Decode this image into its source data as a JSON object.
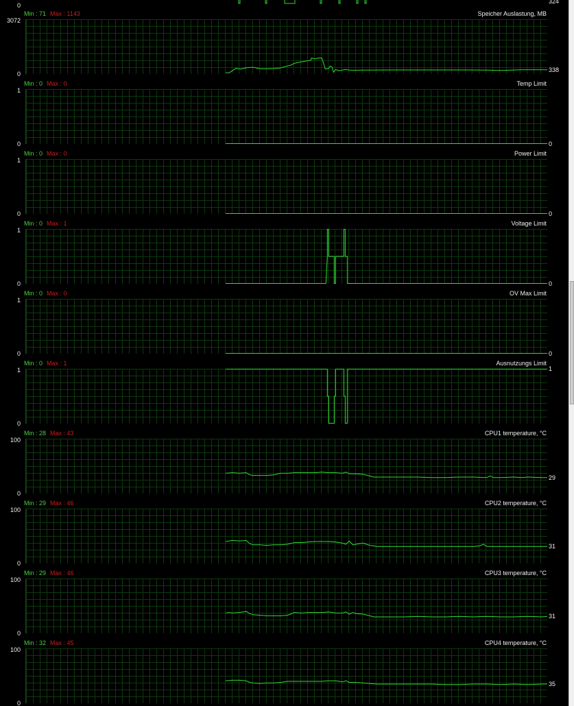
{
  "colors": {
    "line": "#32dc32",
    "min": "#4ccf40",
    "max": "#c81e1e",
    "text": "#f0f0f0",
    "grid": "#0d3a0d"
  },
  "top_partial": {
    "ymin": "0",
    "current": "324"
  },
  "panels": [
    {
      "title": "Speicher Auslastung, MB",
      "min_label": "Min : 71",
      "max_label": "Max : 1143",
      "ymax": "3072",
      "ymin": "0",
      "current": "338",
      "range": [
        0,
        3072
      ],
      "chart_data": {
        "type": "line",
        "x": [
          0,
          5,
          10,
          15,
          22,
          30,
          33,
          40,
          50,
          60,
          70,
          80,
          90,
          95,
          100,
          110,
          120,
          124,
          125,
          130,
          135,
          140,
          145,
          150,
          152,
          155,
          157,
          160,
          165,
          175,
          180,
          185,
          200,
          250,
          300,
          350,
          380,
          400,
          430,
          468
        ],
        "y": [
          71,
          70,
          190,
          320,
          280,
          350,
          360,
          380,
          300,
          290,
          310,
          340,
          450,
          500,
          600,
          680,
          750,
          780,
          900,
          850,
          900,
          900,
          280,
          310,
          450,
          380,
          100,
          250,
          190,
          260,
          220,
          210,
          220,
          230,
          230,
          230,
          220,
          200,
          240,
          240
        ]
      }
    },
    {
      "title": "Temp Limit",
      "min_label": "Min : 0",
      "max_label": "Max : 0",
      "ymax": "1",
      "ymin": "0",
      "current": "0",
      "range": [
        0,
        1
      ],
      "chart_data": {
        "type": "line",
        "x": [
          0,
          468
        ],
        "y": [
          0,
          0
        ]
      }
    },
    {
      "title": "Power Limit",
      "min_label": "Min : 0",
      "max_label": "Max : 0",
      "ymax": "1",
      "ymin": "0",
      "current": "0",
      "range": [
        0,
        1
      ],
      "chart_data": {
        "type": "line",
        "x": [
          0,
          468
        ],
        "y": [
          0,
          0
        ]
      }
    },
    {
      "title": "Voltage Limit",
      "min_label": "Min : 0",
      "max_label": "Max : 1",
      "ymax": "1",
      "ymin": "0",
      "current": "0",
      "range": [
        0,
        1
      ],
      "chart_data": {
        "type": "line",
        "x": [
          0,
          146,
          148,
          148,
          150,
          150,
          158,
          158,
          160,
          160,
          172,
          172,
          174,
          174,
          177,
          177,
          179,
          179,
          468
        ],
        "y": [
          0,
          0,
          0.5,
          1,
          1,
          0.5,
          0.5,
          0,
          0,
          0.5,
          0.5,
          1,
          1,
          0.5,
          0.5,
          0,
          0,
          0,
          0
        ]
      }
    },
    {
      "title": "OV Max Limit",
      "min_label": "Min : 0",
      "max_label": "Max : 0",
      "ymax": "1",
      "ymin": "0",
      "current": "0",
      "range": [
        0,
        1
      ],
      "chart_data": {
        "type": "line",
        "x": [
          0,
          468
        ],
        "y": [
          0,
          0
        ]
      }
    },
    {
      "title": "Ausnutzungs Limit",
      "min_label": "Min : 0",
      "max_label": "Max : 1",
      "ymax": "1",
      "ymin": "0",
      "current": "1",
      "range": [
        0,
        1
      ],
      "chart_data": {
        "type": "line",
        "x": [
          0,
          146,
          148,
          148,
          150,
          150,
          158,
          158,
          160,
          160,
          172,
          172,
          174,
          174,
          177,
          177,
          179,
          179,
          468
        ],
        "y": [
          1,
          1,
          1,
          0.5,
          0.5,
          0,
          0,
          0.5,
          0.5,
          1,
          1,
          0.5,
          0.5,
          0,
          0,
          1,
          1,
          1,
          1
        ]
      }
    },
    {
      "title": "CPU1 temperature, °C",
      "min_label": "Min : 28",
      "max_label": "Max : 43",
      "ymax": "100",
      "ymin": "0",
      "current": "29",
      "range": [
        0,
        100
      ],
      "chart_data": {
        "type": "line",
        "x": [
          0,
          10,
          20,
          30,
          35,
          40,
          50,
          60,
          70,
          80,
          90,
          100,
          110,
          120,
          130,
          140,
          150,
          160,
          170,
          175,
          180,
          190,
          200,
          210,
          215,
          220,
          240,
          260,
          280,
          300,
          320,
          340,
          360,
          380,
          385,
          390,
          400,
          420,
          430,
          440,
          460,
          468
        ],
        "y": [
          37,
          38,
          37,
          38,
          34,
          33,
          33,
          33,
          34,
          37,
          37,
          38,
          38,
          38,
          38,
          39,
          38,
          38,
          37,
          39,
          36,
          36,
          35,
          32,
          30,
          30,
          30,
          30,
          30,
          29,
          29,
          30,
          30,
          29,
          32,
          29,
          29,
          30,
          29,
          30,
          29,
          29
        ]
      }
    },
    {
      "title": "CPU2 temperature, °C",
      "min_label": "Min : 29",
      "max_label": "Max : 46",
      "ymax": "100",
      "ymin": "0",
      "current": "31",
      "range": [
        0,
        100
      ],
      "chart_data": {
        "type": "line",
        "x": [
          0,
          5,
          10,
          20,
          30,
          35,
          40,
          50,
          60,
          70,
          80,
          90,
          100,
          110,
          120,
          130,
          140,
          150,
          160,
          170,
          175,
          180,
          185,
          190,
          200,
          210,
          215,
          220,
          240,
          260,
          280,
          300,
          320,
          340,
          360,
          370,
          375,
          380,
          400,
          420,
          440,
          460,
          468
        ],
        "y": [
          40,
          41,
          42,
          41,
          42,
          36,
          34,
          34,
          33,
          34,
          34,
          35,
          38,
          38,
          39,
          40,
          40,
          40,
          39,
          37,
          35,
          41,
          34,
          35,
          37,
          33,
          32,
          31,
          31,
          31,
          31,
          31,
          31,
          31,
          31,
          32,
          35,
          31,
          31,
          31,
          31,
          31,
          31
        ]
      }
    },
    {
      "title": "CPU3 temperature, °C",
      "min_label": "Min : 29",
      "max_label": "Max : 46",
      "ymax": "100",
      "ymin": "0",
      "current": "31",
      "range": [
        0,
        100
      ],
      "chart_data": {
        "type": "line",
        "x": [
          0,
          5,
          10,
          20,
          30,
          35,
          40,
          50,
          60,
          70,
          80,
          90,
          100,
          110,
          120,
          130,
          140,
          150,
          160,
          170,
          175,
          180,
          185,
          190,
          200,
          210,
          215,
          220,
          240,
          260,
          280,
          300,
          320,
          340,
          360,
          380,
          400,
          420,
          440,
          460,
          468
        ],
        "y": [
          37,
          38,
          37,
          38,
          40,
          36,
          34,
          33,
          32,
          32,
          32,
          33,
          38,
          37,
          38,
          38,
          38,
          39,
          37,
          37,
          39,
          35,
          38,
          36,
          35,
          32,
          30,
          30,
          30,
          30,
          31,
          30,
          30,
          31,
          30,
          31,
          30,
          30,
          31,
          30,
          31
        ]
      }
    },
    {
      "title": "CPU4 temperature, °C",
      "min_label": "Min : 32",
      "max_label": "Max : 45",
      "ymax": "100",
      "ymin": "0",
      "current": "35",
      "range": [
        0,
        100
      ],
      "chart_data": {
        "type": "line",
        "x": [
          0,
          10,
          20,
          30,
          35,
          40,
          50,
          60,
          70,
          80,
          90,
          100,
          110,
          120,
          130,
          140,
          150,
          160,
          170,
          175,
          180,
          190,
          200,
          210,
          220,
          240,
          260,
          280,
          300,
          320,
          340,
          360,
          380,
          400,
          420,
          440,
          460,
          468
        ],
        "y": [
          41,
          42,
          42,
          41,
          38,
          37,
          36,
          37,
          37,
          38,
          40,
          40,
          40,
          40,
          40,
          40,
          41,
          41,
          39,
          41,
          38,
          38,
          37,
          36,
          35,
          35,
          35,
          35,
          35,
          34,
          34,
          35,
          35,
          34,
          35,
          34,
          35,
          35
        ]
      }
    }
  ]
}
